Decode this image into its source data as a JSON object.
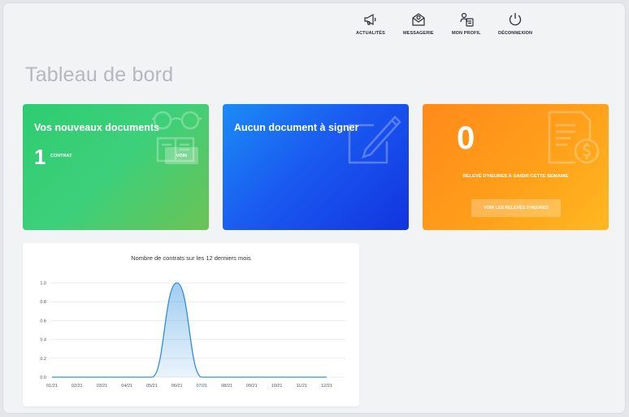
{
  "nav": {
    "items": [
      {
        "label": "ACTUALITÉS",
        "icon": "megaphone-icon"
      },
      {
        "label": "MESSAGERIE",
        "icon": "mail-icon"
      },
      {
        "label": "MON PROFIL",
        "icon": "profile-icon"
      },
      {
        "label": "DÉCONNEXION",
        "icon": "power-icon"
      }
    ]
  },
  "page": {
    "title": "Tableau de bord"
  },
  "cards": {
    "documents": {
      "title": "Vos nouveaux documents",
      "count": "1",
      "count_label": "CONTRAT",
      "button": "VOIR",
      "color": "#2ecc71",
      "icon": "glasses-book-icon"
    },
    "signature": {
      "title": "Aucun document à signer",
      "color": "#1a5af0",
      "icon": "sign-pen-icon"
    },
    "timesheet": {
      "count": "0",
      "label": "RELEVÉ D'HEURES À SAISIR CETTE SEMAINE",
      "button": "VOIR LES RELEVÉS D'HEURES",
      "color": "#ff9d1a",
      "icon": "invoice-dollar-icon"
    }
  },
  "chart_data": {
    "type": "area",
    "title": "Nombre de contrats sur les 12 derniers mois",
    "categories": [
      "01/21",
      "02/21",
      "03/21",
      "04/21",
      "05/21",
      "06/21",
      "07/21",
      "08/21",
      "09/21",
      "10/21",
      "11/21",
      "12/21"
    ],
    "values": [
      0,
      0,
      0,
      0,
      0,
      1,
      0,
      0,
      0,
      0,
      0,
      0
    ],
    "ylim": [
      0,
      1
    ],
    "yticks": [
      "0.0",
      "0.2",
      "0.4",
      "0.6",
      "0.8",
      "1.0"
    ],
    "color": "#2d8fe0",
    "grid": true
  }
}
